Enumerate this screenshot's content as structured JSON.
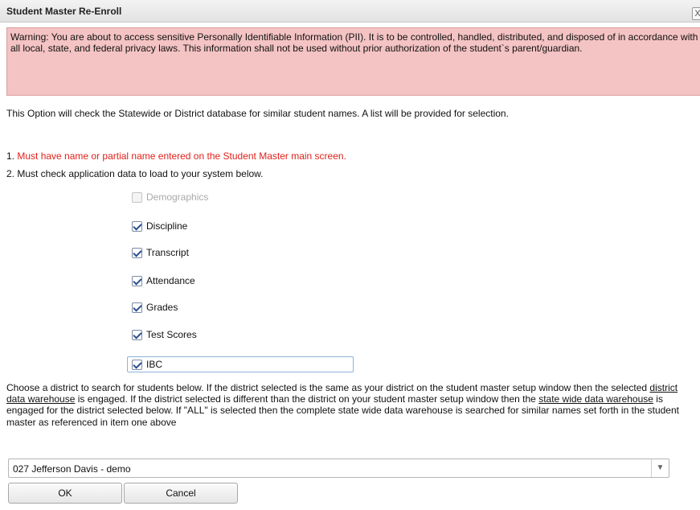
{
  "window": {
    "title": "Student Master Re-Enroll",
    "close_glyph": "X"
  },
  "warning": "Warning: You are about to access sensitive Personally Identifiable Information (PII). It is to be controlled, handled, distributed, and disposed of in accordance with all local, state, and federal privacy laws. This information shall not be used without prior authorization of the student`s parent/guardian.",
  "intro": "This Option will check the Statewide or District database for similar student names. A list will be provided for selection.",
  "requirements": {
    "item1_number": "1.",
    "item1_text": "Must have name or partial name entered on the Student Master main screen.",
    "item2": "2. Must check application data to load to your system below."
  },
  "options": [
    {
      "label": "Demographics",
      "checked": false,
      "disabled": true
    },
    {
      "label": "Discipline",
      "checked": true,
      "disabled": false
    },
    {
      "label": "Transcript",
      "checked": true,
      "disabled": false
    },
    {
      "label": "Attendance",
      "checked": true,
      "disabled": false
    },
    {
      "label": "Grades",
      "checked": true,
      "disabled": false
    },
    {
      "label": "Test Scores",
      "checked": true,
      "disabled": false
    },
    {
      "label": "IBC",
      "checked": true,
      "disabled": false
    }
  ],
  "district_paragraph": {
    "part1": "Choose a district to search for students below. If the district selected is the same as your district on the student master setup window then the selected ",
    "link1": "district data warehouse",
    "part2": " is engaged. If the district selected is different than the district on your student master setup window then the ",
    "link2": "state wide data warehouse",
    "part3": " is engaged for the district selected below. If \"ALL\" is selected then the complete state wide data warehouse is searched for similar names set forth in the student master as referenced in item one above"
  },
  "district_select": {
    "value": "027 Jefferson Davis - demo",
    "arrow_icon": "chevron-down-icon"
  },
  "buttons": {
    "ok": "OK",
    "cancel": "Cancel"
  },
  "colors": {
    "warning_bg": "#f4c3c3",
    "required_text": "#e0211b"
  }
}
